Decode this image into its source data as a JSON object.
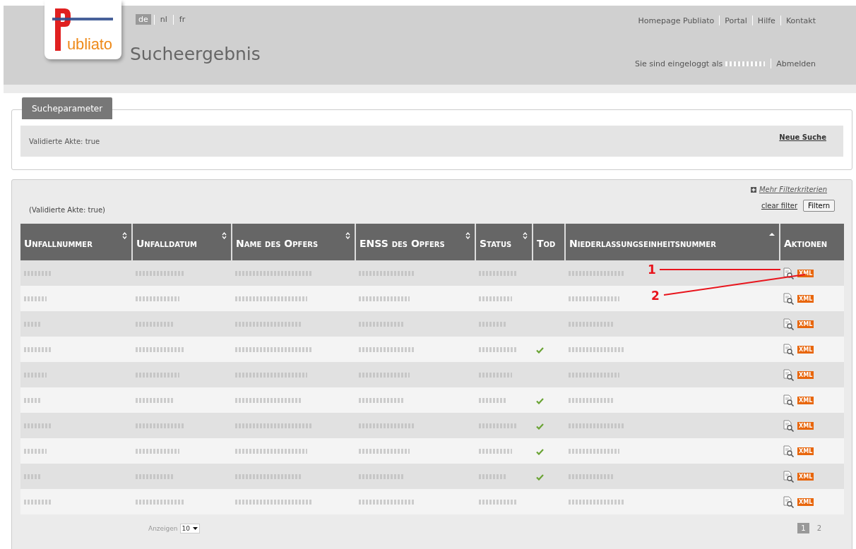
{
  "header": {
    "logo_text_plain": "ubliato",
    "languages": [
      {
        "label": "de",
        "selected": true
      },
      {
        "label": "nl",
        "selected": false
      },
      {
        "label": "fr",
        "selected": false
      }
    ],
    "page_title": "Sucheergebnis",
    "top_links": [
      "Homepage Publiato",
      "Portal",
      "Hilfe",
      "Kontakt"
    ],
    "logged_in_label": "Sie sind eingeloggt als",
    "logout": "Abmelden"
  },
  "search_parameters": {
    "tab": "Sucheparameter",
    "summary": "Validierte Akte: true",
    "new_search": "Neue Suche"
  },
  "results": {
    "more_filters": "Mehr Filterkriterien",
    "filter_summary": "(Validierte Akte: true)",
    "clear_filter": "clear filter",
    "filter_button": "Filtern",
    "columns": [
      {
        "label": "Unfallnummer",
        "sortable": true,
        "sorted": false
      },
      {
        "label": "Unfalldatum",
        "sortable": true,
        "sorted": false
      },
      {
        "label": "Name des Opfers",
        "sortable": true,
        "sorted": false
      },
      {
        "label": "ENSS des Opfers",
        "sortable": true,
        "sorted": false
      },
      {
        "label": "Status",
        "sortable": true,
        "sorted": false
      },
      {
        "label": "Tod",
        "sortable": false,
        "sorted": false
      },
      {
        "label": "Niederlassungseinheitsnummer",
        "sortable": true,
        "sorted": true
      },
      {
        "label": "Aktionen",
        "sortable": false,
        "sorted": false
      }
    ],
    "rows": [
      {
        "dead": false,
        "export_label": "XML"
      },
      {
        "dead": false,
        "export_label": "XML"
      },
      {
        "dead": false,
        "export_label": "XML"
      },
      {
        "dead": true,
        "export_label": "XML"
      },
      {
        "dead": false,
        "export_label": "XML"
      },
      {
        "dead": true,
        "export_label": "XML"
      },
      {
        "dead": true,
        "export_label": "XML"
      },
      {
        "dead": true,
        "export_label": "XML"
      },
      {
        "dead": true,
        "export_label": "XML"
      },
      {
        "dead": false,
        "export_label": "XML"
      }
    ],
    "annotations": [
      {
        "label": "1"
      },
      {
        "label": "2"
      }
    ],
    "page_size_label": "Anzeigen",
    "page_size": "10",
    "pages": [
      {
        "label": "1",
        "selected": true
      },
      {
        "label": "2",
        "selected": false
      }
    ]
  }
}
